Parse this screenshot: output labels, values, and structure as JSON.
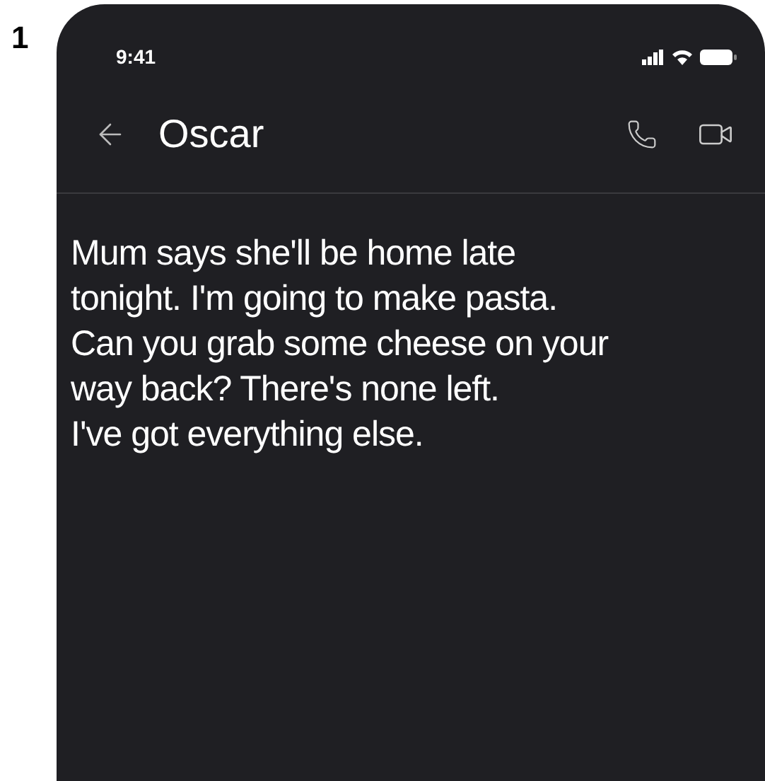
{
  "label": "1",
  "status_bar": {
    "time": "9:41"
  },
  "header": {
    "title": "Oscar"
  },
  "message": {
    "lines": [
      "Mum says she'll be home late",
      "tonight. I'm going to make pasta.",
      "Can you grab some cheese on your",
      "way back? There's none left.",
      "I've got everything else."
    ]
  }
}
